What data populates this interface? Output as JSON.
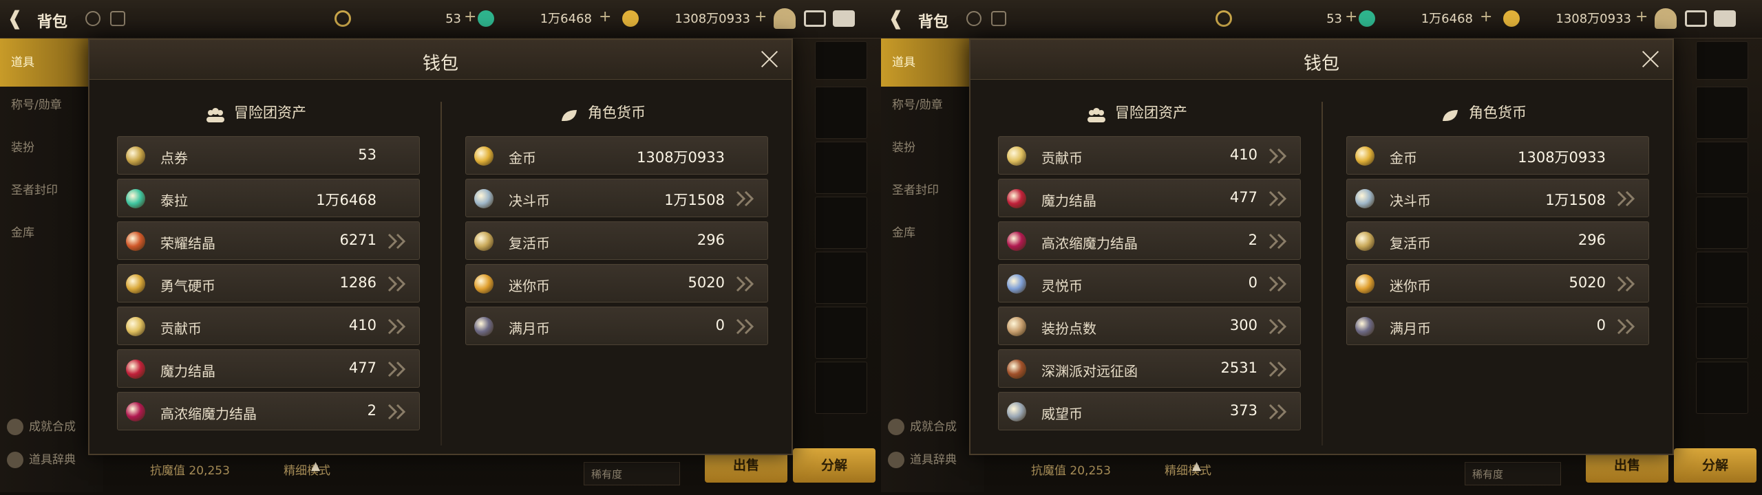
{
  "topbar": {
    "title": "背包",
    "dianquan": "53",
    "taila": "1万6468",
    "gold": "1308万0933"
  },
  "sidebar": {
    "tabs": [
      "道具",
      "称号/勋章",
      "装扮",
      "圣者封印",
      "金库"
    ],
    "bottom": [
      "成就合成",
      "道具辞典"
    ]
  },
  "bottombar": {
    "ms_label": "抗魔值 20,253",
    "fine_label": "精细模式",
    "sort_label": "稀有度",
    "sell_label": "出售",
    "decompose_label": "分解"
  },
  "modal": {
    "title": "钱包",
    "left_header": "冒险团资产",
    "right_header": "角色货币"
  },
  "left_screen": {
    "adventure": [
      {
        "name": "点券",
        "value": "53",
        "icon": "coupon-icon",
        "arrow": false
      },
      {
        "name": "泰拉",
        "value": "1万6468",
        "icon": "tera-icon",
        "arrow": false
      },
      {
        "name": "荣耀结晶",
        "value": "6271",
        "icon": "glory-icon",
        "arrow": true
      },
      {
        "name": "勇气硬币",
        "value": "1286",
        "icon": "courage-coin-icon",
        "arrow": true
      },
      {
        "name": "贡献币",
        "value": "410",
        "icon": "contribution-icon",
        "arrow": true
      },
      {
        "name": "魔力结晶",
        "value": "477",
        "icon": "magic-crystal-icon",
        "arrow": true
      },
      {
        "name": "高浓缩魔力结晶",
        "value": "2",
        "icon": "concentrated-crystal-icon",
        "arrow": true
      }
    ],
    "character": [
      {
        "name": "金币",
        "value": "1308万0933",
        "icon": "gold-icon",
        "arrow": false
      },
      {
        "name": "决斗币",
        "value": "1万1508",
        "icon": "duel-coin-icon",
        "arrow": true
      },
      {
        "name": "复活币",
        "value": "296",
        "icon": "revive-coin-icon",
        "arrow": false
      },
      {
        "name": "迷你币",
        "value": "5020",
        "icon": "mini-coin-icon",
        "arrow": true
      },
      {
        "name": "满月币",
        "value": "0",
        "icon": "fullmoon-coin-icon",
        "arrow": true
      }
    ]
  },
  "right_screen": {
    "adventure": [
      {
        "name": "贡献币",
        "value": "410",
        "icon": "contribution-icon",
        "arrow": true
      },
      {
        "name": "魔力结晶",
        "value": "477",
        "icon": "magic-crystal-icon",
        "arrow": true
      },
      {
        "name": "高浓缩魔力结晶",
        "value": "2",
        "icon": "concentrated-crystal-icon",
        "arrow": true
      },
      {
        "name": "灵悦币",
        "value": "0",
        "icon": "lingyue-coin-icon",
        "arrow": true
      },
      {
        "name": "装扮点数",
        "value": "300",
        "icon": "costume-points-icon",
        "arrow": true
      },
      {
        "name": "深渊派对远征函",
        "value": "2531",
        "icon": "abyss-letter-icon",
        "arrow": true
      },
      {
        "name": "威望币",
        "value": "373",
        "icon": "prestige-coin-icon",
        "arrow": true
      }
    ],
    "character": [
      {
        "name": "金币",
        "value": "1308万0933",
        "icon": "gold-icon",
        "arrow": false
      },
      {
        "name": "决斗币",
        "value": "1万1508",
        "icon": "duel-coin-icon",
        "arrow": true
      },
      {
        "name": "复活币",
        "value": "296",
        "icon": "revive-coin-icon",
        "arrow": false
      },
      {
        "name": "迷你币",
        "value": "5020",
        "icon": "mini-coin-icon",
        "arrow": true
      },
      {
        "name": "满月币",
        "value": "0",
        "icon": "fullmoon-coin-icon",
        "arrow": true
      }
    ]
  },
  "icon_colors": {
    "coupon-icon": "#c9a64a",
    "tera-icon": "#3fc5a0",
    "glory-icon": "#d0582a",
    "courage-coin-icon": "#d9a83a",
    "contribution-icon": "#e0c060",
    "magic-crystal-icon": "#c0203a",
    "concentrated-crystal-icon": "#b01850",
    "lingyue-coin-icon": "#7fa0d8",
    "costume-points-icon": "#c8a070",
    "abyss-letter-icon": "#a0502a",
    "prestige-coin-icon": "#9aa7b5",
    "gold-icon": "#e2b23a",
    "duel-coin-icon": "#9fb7c9",
    "revive-coin-icon": "#c9a95a",
    "mini-coin-icon": "#e0a030",
    "fullmoon-coin-icon": "#6d6a86"
  }
}
